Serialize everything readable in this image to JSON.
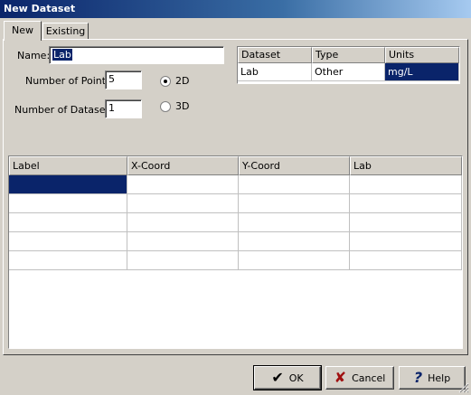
{
  "window": {
    "title": "New Dataset"
  },
  "tabs": [
    {
      "label": "New"
    },
    {
      "label": "Existing"
    }
  ],
  "form": {
    "name_label": "Name:",
    "name_value": "Lab",
    "points_label": "Number of Points:",
    "points_value": "5",
    "datasets_label": "Number of Datasets:",
    "datasets_value": "1",
    "radio_2d_label": "2D",
    "radio_3d_label": "3D",
    "selected_dimension": "2D"
  },
  "dataset_table": {
    "headers": [
      "Dataset",
      "Type",
      "Units"
    ],
    "rows": [
      [
        "Lab",
        "Other",
        "mg/L"
      ]
    ]
  },
  "data_grid": {
    "headers": [
      "Label",
      "X-Coord",
      "Y-Coord",
      "Lab"
    ],
    "rows": [
      [
        "",
        "",
        "",
        ""
      ],
      [
        "",
        "",
        "",
        ""
      ],
      [
        "",
        "",
        "",
        ""
      ],
      [
        "",
        "",
        "",
        ""
      ],
      [
        "",
        "",
        "",
        ""
      ]
    ]
  },
  "buttons": {
    "ok": "OK",
    "cancel": "Cancel",
    "help": "Help"
  },
  "colors": {
    "selection": "#0a246a",
    "face": "#d4d0c8",
    "cancel_icon": "#a01010",
    "ok_icon": "#000000",
    "help_icon": "#0a246a"
  }
}
